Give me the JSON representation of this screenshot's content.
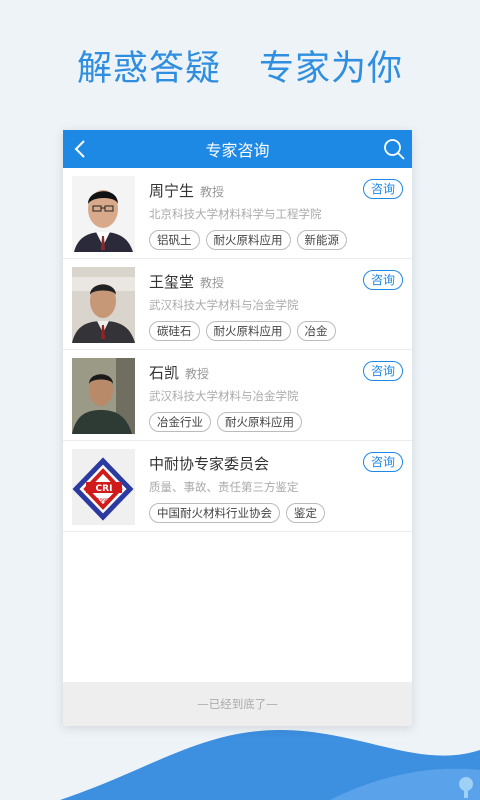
{
  "headline": {
    "left": "解惑答疑",
    "right": "专家为你"
  },
  "topbar": {
    "title": "专家咨询"
  },
  "experts": [
    {
      "name": "周宁生",
      "title": "教授",
      "institution": "北京科技大学材料科学与工程学院",
      "tags": [
        "铝矾土",
        "耐火原料应用",
        "新能源"
      ],
      "action": "咨询"
    },
    {
      "name": "王玺堂",
      "title": "教授",
      "institution": "武汉科技大学材料与冶金学院",
      "tags": [
        "碳硅石",
        "耐火原料应用",
        "冶金"
      ],
      "action": "咨询"
    },
    {
      "name": "石凯",
      "title": "教授",
      "institution": "武汉科技大学材料与冶金学院",
      "tags": [
        "冶金行业",
        "耐火原料应用"
      ],
      "action": "咨询"
    },
    {
      "name": "中耐协专家委员会",
      "title": "",
      "institution": "质量、事故、责任第三方鉴定",
      "tags": [
        "中国耐火材料行业协会",
        "鉴定"
      ],
      "action": "咨询",
      "logo_text": "CRI",
      "logo_year": "1990"
    }
  ],
  "footer": {
    "text": "—已经到底了—"
  },
  "colors": {
    "accent": "#1e88e5",
    "headline": "#2f8ee0"
  }
}
